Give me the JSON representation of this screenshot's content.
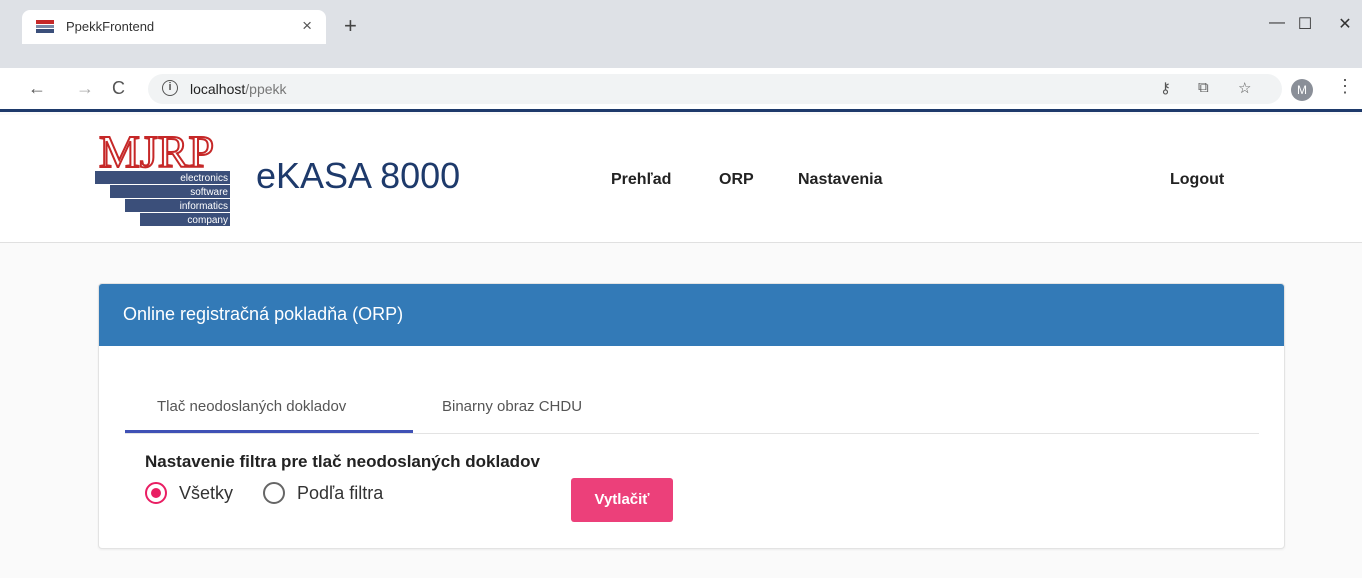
{
  "browser": {
    "tab_title": "PpekkFrontend",
    "tab_close": "×",
    "new_tab": "+",
    "window": {
      "minimize": "—",
      "maximize": "☐",
      "close": "✕"
    },
    "url_host": "localhost",
    "url_path": "/ppekk",
    "avatar_letter": "M"
  },
  "header": {
    "logo_letters": "MJRP",
    "logo_lines": [
      "electronics",
      "software",
      "informatics",
      "company"
    ],
    "brand": "eKASA 8000",
    "nav": [
      "Prehľad",
      "ORP",
      "Nastavenia"
    ],
    "logout": "Logout"
  },
  "card": {
    "title": "Online registračná pokladňa (ORP)",
    "tabs": [
      "Tlač neodoslaných dokladov",
      "Binarny obraz CHDU"
    ],
    "active_tab": 0,
    "filter_title": "Nastavenie filtra pre tlač neodoslaných dokladov",
    "radio_options": [
      "Všetky",
      "Podľa filtra"
    ],
    "selected_option": 0,
    "print_button": "Vytlačiť"
  },
  "colors": {
    "brand": "#1e3a6b",
    "header_bar": "#337ab7",
    "accent": "#e91e63",
    "button": "#ec407a",
    "tab_indicator": "#3f51b5"
  }
}
